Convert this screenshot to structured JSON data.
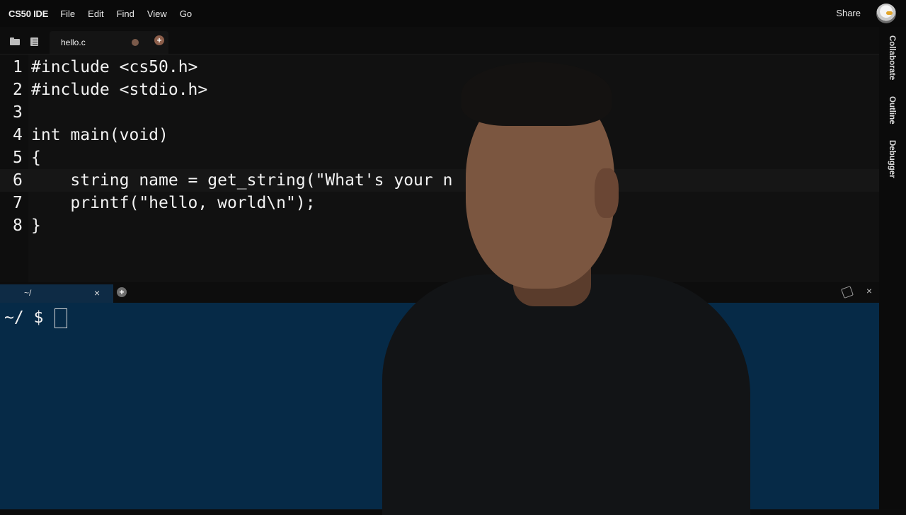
{
  "menubar": {
    "brand": "CS50 IDE",
    "items": [
      "File",
      "Edit",
      "Find",
      "View",
      "Go"
    ],
    "share": "Share"
  },
  "sidepanel": {
    "tabs": [
      "Collaborate",
      "Outline",
      "Debugger"
    ]
  },
  "editor_tabs": {
    "active_file": "hello.c",
    "add": "+"
  },
  "editor": {
    "lines": [
      {
        "n": "1",
        "text": "#include <cs50.h>"
      },
      {
        "n": "2",
        "text": "#include <stdio.h>"
      },
      {
        "n": "3",
        "text": ""
      },
      {
        "n": "4",
        "text": "int main(void)"
      },
      {
        "n": "5",
        "text": "{"
      },
      {
        "n": "6",
        "text": "    string name = get_string(\"What's your n"
      },
      {
        "n": "7",
        "text": "    printf(\"hello, world\\n\");"
      },
      {
        "n": "8",
        "text": "}"
      }
    ],
    "active_line": 6
  },
  "terminal": {
    "tab_label": "~/",
    "close": "×",
    "add": "+",
    "panel_close": "×",
    "prompt": "~/ $"
  },
  "icons": {
    "folder": "folder-icon",
    "file": "file-list-icon",
    "avatar": "duck-avatar-icon",
    "maximize": "maximize-icon"
  },
  "colors": {
    "terminal_bg": "#062a47",
    "editor_bg": "#111111",
    "accent": "#8c5e4a"
  }
}
